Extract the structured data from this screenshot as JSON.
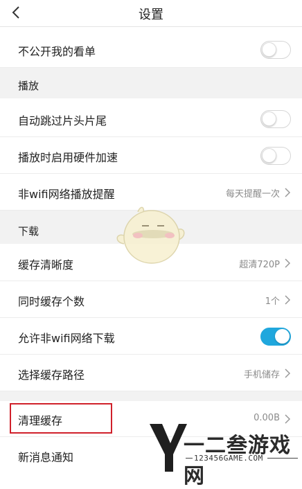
{
  "header": {
    "title": "设置",
    "back": "back-icon"
  },
  "rows": {
    "private_list": {
      "label": "不公开我的看单",
      "toggle": "off"
    },
    "skip_intro": {
      "label": "自动跳过片头片尾",
      "toggle": "off"
    },
    "hw_accel": {
      "label": "播放时启用硬件加速",
      "toggle": "off"
    },
    "nonwifi_play": {
      "label": "非wifi网络播放提醒",
      "value": "每天提醒一次"
    },
    "cache_quality": {
      "label": "缓存清晰度",
      "value": "超清720P"
    },
    "cache_count": {
      "label": "同时缓存个数",
      "value": "1个"
    },
    "nonwifi_download": {
      "label": "允许非wifi网络下载",
      "toggle": "on"
    },
    "cache_path": {
      "label": "选择缓存路径",
      "value": "手机储存"
    },
    "clear_cache": {
      "label": "清理缓存",
      "value": "0.00B"
    },
    "notifications": {
      "label": "新消息通知"
    }
  },
  "sections": {
    "playback": "播放",
    "download": "下载"
  },
  "watermark": {
    "brand": "一二叁游戏网",
    "url": "123456GAME.COM"
  },
  "colors": {
    "accent": "#20a7dd",
    "highlight": "#d0202a",
    "section_bg": "#f2f2f2"
  }
}
